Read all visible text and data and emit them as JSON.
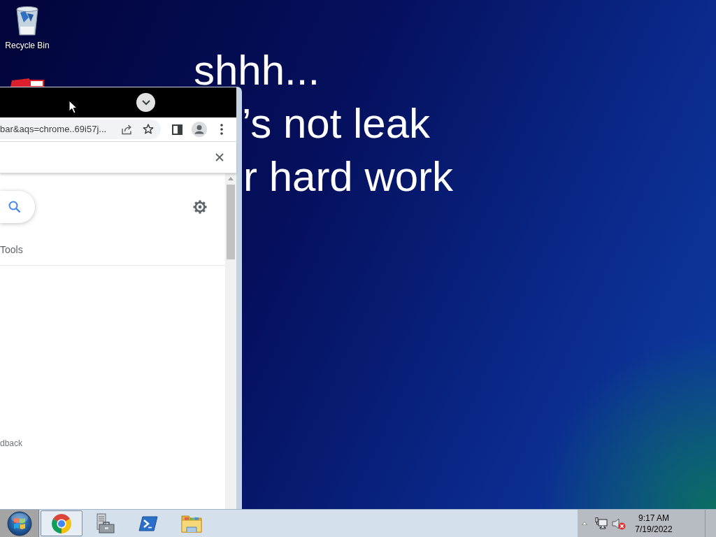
{
  "desktop": {
    "icons": [
      {
        "label": "Recycle Bin"
      }
    ],
    "wallpaper_text": [
      "shhh...",
      "’s not leak",
      "r hard work"
    ]
  },
  "browser": {
    "address_bar": {
      "value": "bar&aqs=chrome..69i57j..."
    },
    "page": {
      "tools_link": "Tools",
      "feedback_link": "dback"
    }
  },
  "taskbar": {
    "apps": [
      {
        "kind": "browser",
        "running": true
      },
      {
        "kind": "server",
        "running": false
      },
      {
        "kind": "terminal",
        "running": false
      },
      {
        "kind": "folder",
        "running": false
      }
    ],
    "tray": {
      "volume_muted": true
    },
    "clock": {
      "time": "9:17 AM",
      "date": "7/19/2022"
    }
  }
}
